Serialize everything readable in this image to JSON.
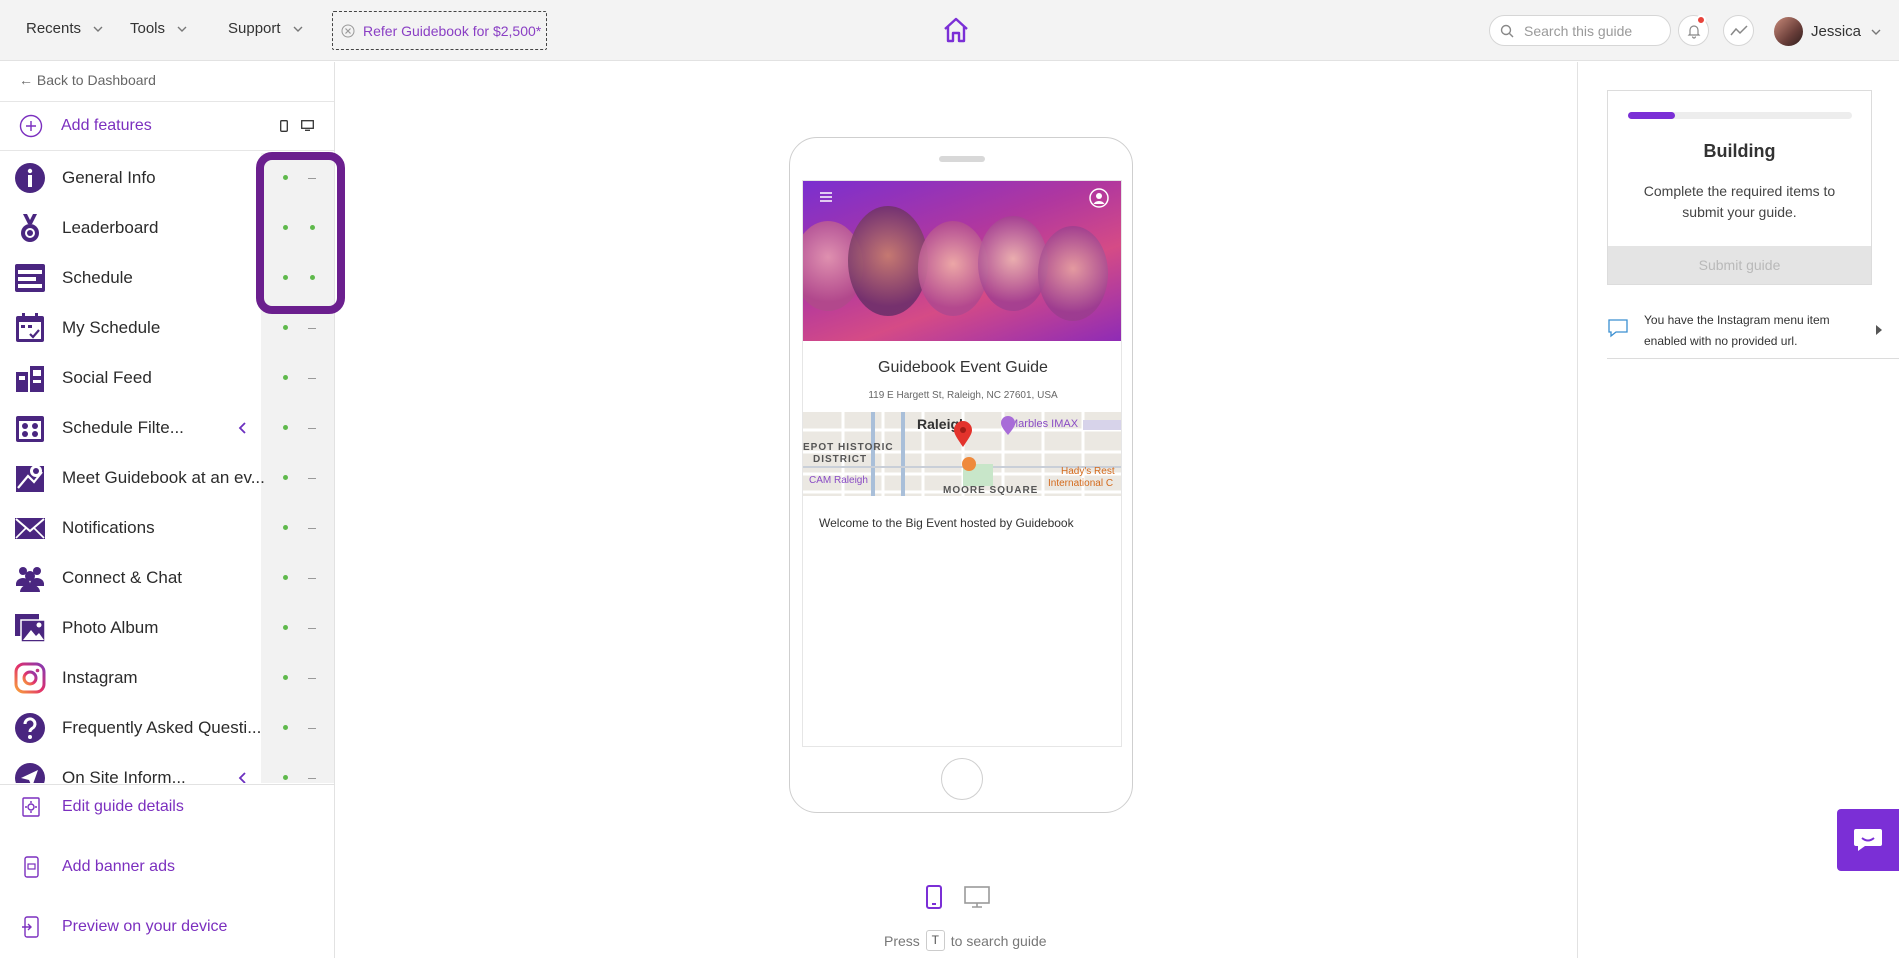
{
  "topbar": {
    "recents_label": "Recents",
    "tools_label": "Tools",
    "support_label": "Support",
    "refer_label": "Refer Guidebook for $2,500*",
    "search_placeholder": "Search this guide",
    "user_name": "Jessica",
    "home_icon": "house-icon",
    "accent_color": "#7b2fbf"
  },
  "sidebar": {
    "back_label": "← Back to Dashboard",
    "add_features_label": "Add features",
    "features": [
      {
        "label": "General Info",
        "icon": "info-icon",
        "mobile": "on",
        "web": "off"
      },
      {
        "label": "Leaderboard",
        "icon": "medal-icon",
        "mobile": "on",
        "web": "on"
      },
      {
        "label": "Schedule",
        "icon": "schedule-icon",
        "mobile": "on",
        "web": "on"
      },
      {
        "label": "My Schedule",
        "icon": "calendar-check-icon",
        "mobile": "on",
        "web": "off"
      },
      {
        "label": "Social Feed",
        "icon": "social-feed-icon",
        "mobile": "on",
        "web": "off"
      },
      {
        "label": "Schedule Filte...",
        "icon": "filter-grid-icon",
        "mobile": "on",
        "web": "off",
        "collapsible": true
      },
      {
        "label": "Meet Guidebook at an ev...",
        "icon": "map-pin-icon",
        "mobile": "on",
        "web": "off"
      },
      {
        "label": "Notifications",
        "icon": "envelope-icon",
        "mobile": "on",
        "web": "off"
      },
      {
        "label": "Connect & Chat",
        "icon": "people-icon",
        "mobile": "on",
        "web": "off"
      },
      {
        "label": "Photo Album",
        "icon": "photo-icon",
        "mobile": "on",
        "web": "off"
      },
      {
        "label": "Instagram",
        "icon": "instagram-icon",
        "mobile": "on",
        "web": "off"
      },
      {
        "label": "Frequently Asked Questi...",
        "icon": "question-icon",
        "mobile": "on",
        "web": "off"
      },
      {
        "label": "On Site Inform...",
        "icon": "send-icon",
        "mobile": "on",
        "web": "off",
        "collapsible": true
      }
    ],
    "bottom_links": [
      {
        "label": "Edit guide details",
        "icon": "edit-details-icon"
      },
      {
        "label": "Add banner ads",
        "icon": "banner-ad-icon"
      },
      {
        "label": "Preview on your device",
        "icon": "preview-device-icon"
      }
    ]
  },
  "preview": {
    "guide_title": "Guidebook Event Guide",
    "address": "119 E Hargett St, Raleigh, NC 27601, USA",
    "map_labels": [
      "Raleigh",
      "Marbles IMAX",
      "EPOT HISTORIC",
      "DISTRICT",
      "CAM Raleigh",
      "MOORE SQUARE",
      "Hady's Rest",
      "International C"
    ],
    "welcome_text": "Welcome to the Big Event hosted by Guidebook",
    "press_label": "Press",
    "press_key": "T",
    "press_suffix": "to search guide"
  },
  "right_panel": {
    "progress": 0.21,
    "status_title": "Building",
    "status_desc": "Complete the required items to submit your guide.",
    "submit_label": "Submit guide",
    "warning_text": "You have the Instagram menu item enabled with no provided url."
  }
}
